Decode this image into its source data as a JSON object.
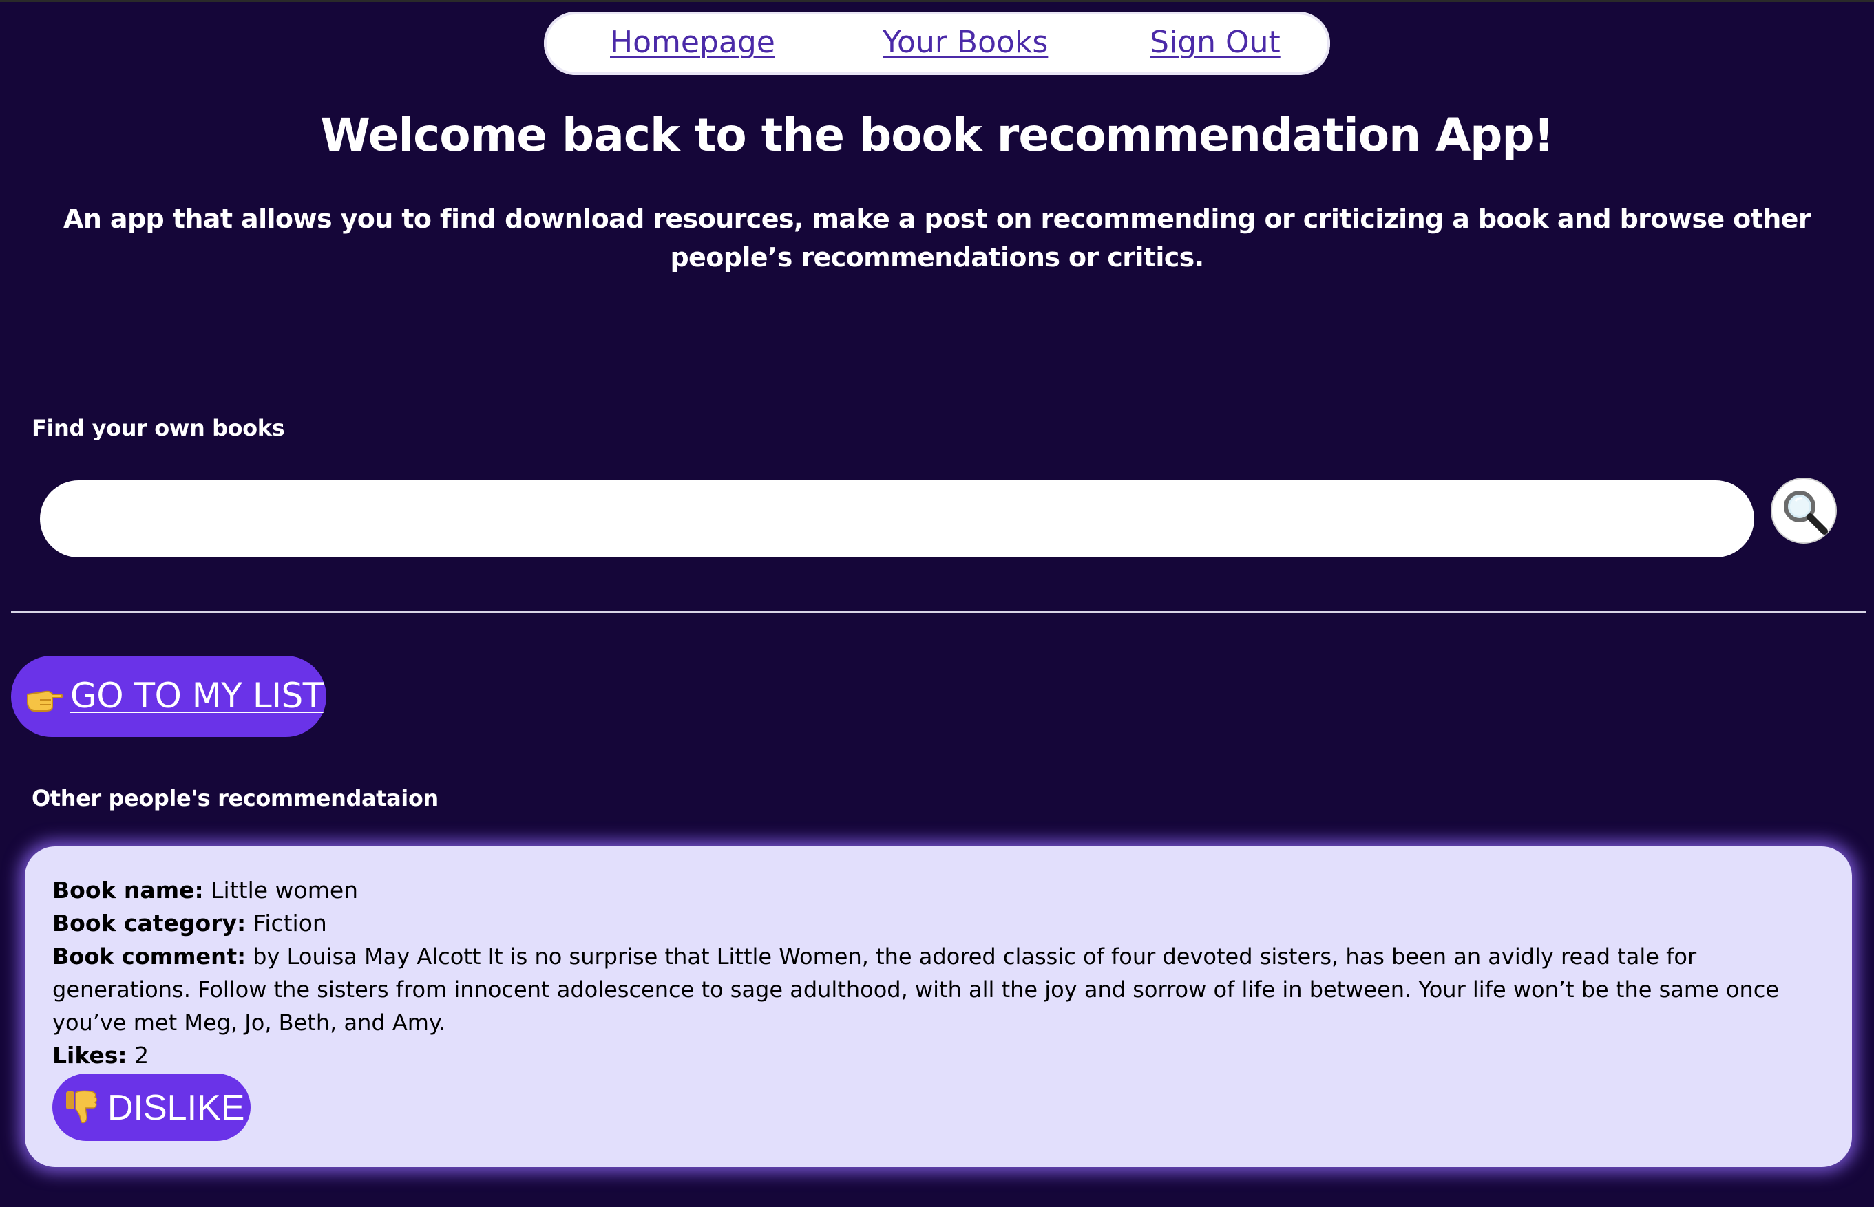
{
  "nav": {
    "items": [
      {
        "label": "Homepage"
      },
      {
        "label": "Your Books"
      },
      {
        "label": "Sign Out"
      }
    ]
  },
  "header": {
    "title": "Welcome back to the book recommendation App!",
    "subtitle": "An app that allows you to find download resources, make a post on recommending or criticizing a book and browse other people’s recommendations or critics."
  },
  "search": {
    "label": "Find your own books",
    "value": "",
    "placeholder": "",
    "button_icon": "magnifying-glass-icon"
  },
  "go_to_list": {
    "icon": "pointing-hand-icon",
    "label": "GO TO MY LIST"
  },
  "recommendations": {
    "label": "Other people's recommendataion",
    "items": [
      {
        "book_name_label": "Book name:",
        "book_name": " Little women",
        "category_label": "Book category:",
        "category": " Fiction",
        "comment_label": "Book comment:",
        "comment": " by Louisa May Alcott It is no surprise that Little Women, the adored classic of four devoted sisters, has been an avidly read tale for generations. Follow the sisters from innocent adolescence to sage adulthood, with all the joy and sorrow of life in between. Your life won’t be the same once you’ve met Meg, Jo, Beth, and Amy.",
        "likes_label": "Likes:",
        "likes": " 2",
        "dislike_icon": "thumbs-down-icon",
        "dislike_label": "DISLIKE"
      }
    ]
  },
  "colors": {
    "background": "#150639",
    "accent": "#6a33e8",
    "card": "#e2dffc",
    "nav_link": "#4b2aa8"
  }
}
